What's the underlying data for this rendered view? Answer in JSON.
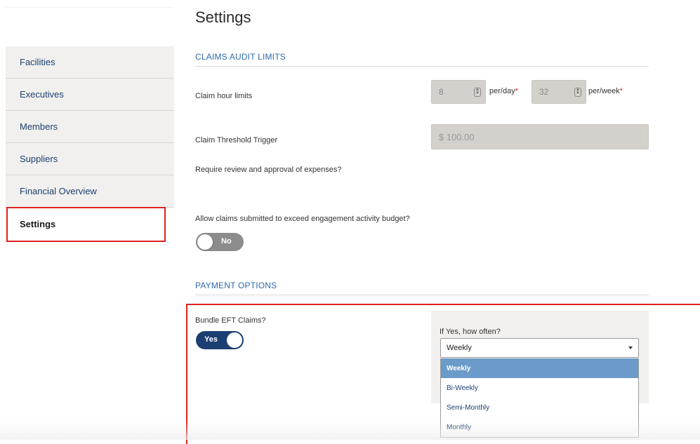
{
  "page": {
    "title": "Settings"
  },
  "sidebar": {
    "items": [
      {
        "label": "Facilities"
      },
      {
        "label": "Executives"
      },
      {
        "label": "Members"
      },
      {
        "label": "Suppliers"
      },
      {
        "label": "Financial Overview"
      },
      {
        "label": "Settings",
        "active": true
      }
    ]
  },
  "claims_audit": {
    "header": "CLAIMS AUDIT LIMITS",
    "hour_limits": {
      "label": "Claim hour limits",
      "per_day_value": "8",
      "per_day_unit": "per/day",
      "per_week_value": "32",
      "per_week_unit": "per/week",
      "required_mark": "*"
    },
    "threshold": {
      "label": "Claim Threshold Trigger",
      "value": "$ 100.00"
    },
    "review_question": "Require review and approval of expenses?",
    "exceed_budget": {
      "label": "Allow claims submitted to exceed engagement activity budget?",
      "toggle_label": "No",
      "state": "off"
    }
  },
  "payment_options": {
    "header": "PAYMENT OPTIONS",
    "bundle_eft": {
      "label": "Bundle EFT Claims?",
      "toggle_label": "Yes",
      "state": "on"
    },
    "frequency": {
      "label": "If Yes, how often?",
      "selected": "Weekly",
      "options": [
        "Weekly",
        "Bi-Weekly",
        "Semi-Monthly",
        "Monthly"
      ]
    }
  },
  "colors": {
    "accent_navy": "#1c3f73",
    "section_blue": "#2f6aa8",
    "highlight_red": "#e02020",
    "selected_option": "#6b9bc9"
  }
}
